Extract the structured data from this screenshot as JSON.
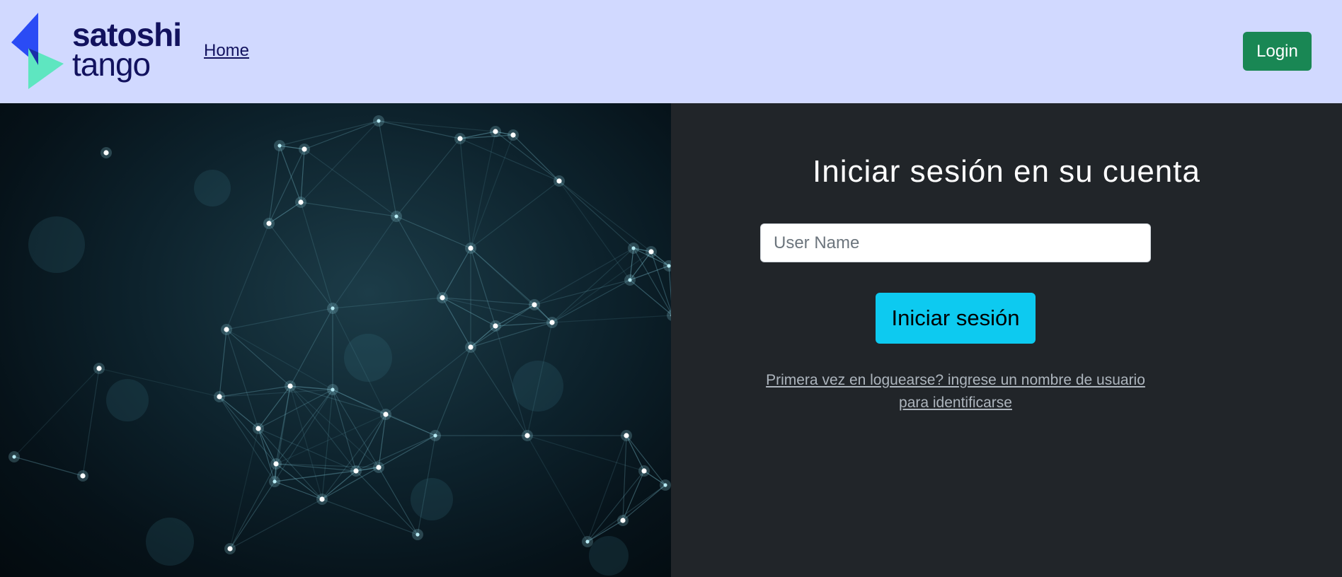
{
  "header": {
    "brand_line1": "satoshi",
    "brand_line2": "tango",
    "nav_home": "Home",
    "login_label": "Login"
  },
  "hero": {
    "icon": "network-mesh-image"
  },
  "login_form": {
    "title": "Iniciar sesión en su cuenta",
    "username_placeholder": "User Name",
    "username_value": "",
    "submit_label": "Iniciar sesión",
    "first_time_text": "Primera vez en loguearse? ingrese un nombre de usuario para identificarse"
  },
  "colors": {
    "navbar_bg": "#d1d9ff",
    "brand_text": "#12125e",
    "login_button": "#198754",
    "panel_bg": "#212529",
    "submit_button": "#0dcaf0",
    "logo_blue": "#2a4bf5",
    "logo_mint": "#5ee6c0"
  }
}
